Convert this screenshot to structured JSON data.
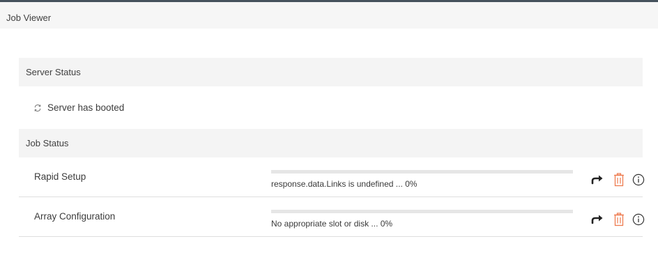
{
  "window": {
    "title": "Job Viewer"
  },
  "server_section": {
    "title": "Server Status",
    "status_text": "Server has booted",
    "status_icon": "refresh-icon"
  },
  "job_section": {
    "title": "Job Status",
    "jobs": [
      {
        "name": "Rapid Setup",
        "message": "response.data.Links is undefined ... 0%",
        "progress": 0,
        "actions": [
          "redo-icon",
          "trash-icon",
          "info-icon"
        ]
      },
      {
        "name": "Array Configuration",
        "message": "No appropriate slot or disk ... 0%",
        "progress": 0,
        "actions": [
          "redo-icon",
          "trash-icon",
          "info-icon"
        ]
      }
    ]
  },
  "colors": {
    "header_border": "#46525d",
    "delete_icon": "#ee7a4e",
    "action_icon": "#222222",
    "progress_track": "#e6e6e6",
    "progress_fill": "#01a982"
  }
}
